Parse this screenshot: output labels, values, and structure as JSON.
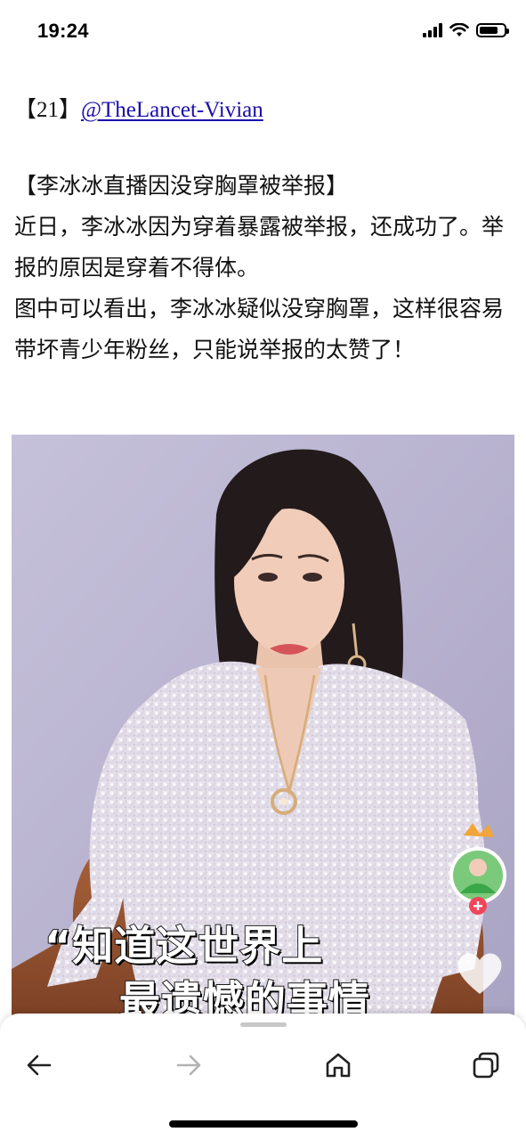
{
  "status_bar": {
    "time": "19:24",
    "icons": [
      "cellular-signal-icon",
      "wifi-icon",
      "battery-icon"
    ]
  },
  "post": {
    "number": "【21】",
    "author": "@TheLancet-Vivian",
    "title": "【李冰冰直播因没穿胸罩被举报】",
    "paragraphs": [
      "近日，李冰冰因为穿着暴露被举报，还成功了。举报的原因是穿着不得体。",
      "图中可以看出，李冰冰疑似没穿胸罩，这样很容易带坏青少年粉丝，只能说举报的太赞了！"
    ]
  },
  "photo": {
    "caption_line_1": "“知道这世界上",
    "caption_line_2": "最遗憾的事情",
    "icons": [
      "streamer-avatar-icon",
      "follow-plus-icon",
      "like-heart-icon"
    ]
  },
  "toolbar": {
    "icons": [
      "back-arrow-icon",
      "forward-arrow-icon",
      "home-icon",
      "tabs-icon"
    ]
  },
  "colors": {
    "link": "#1a0dab",
    "photo_background": "#bdb7d2",
    "follow_badge": "#f0455a"
  }
}
